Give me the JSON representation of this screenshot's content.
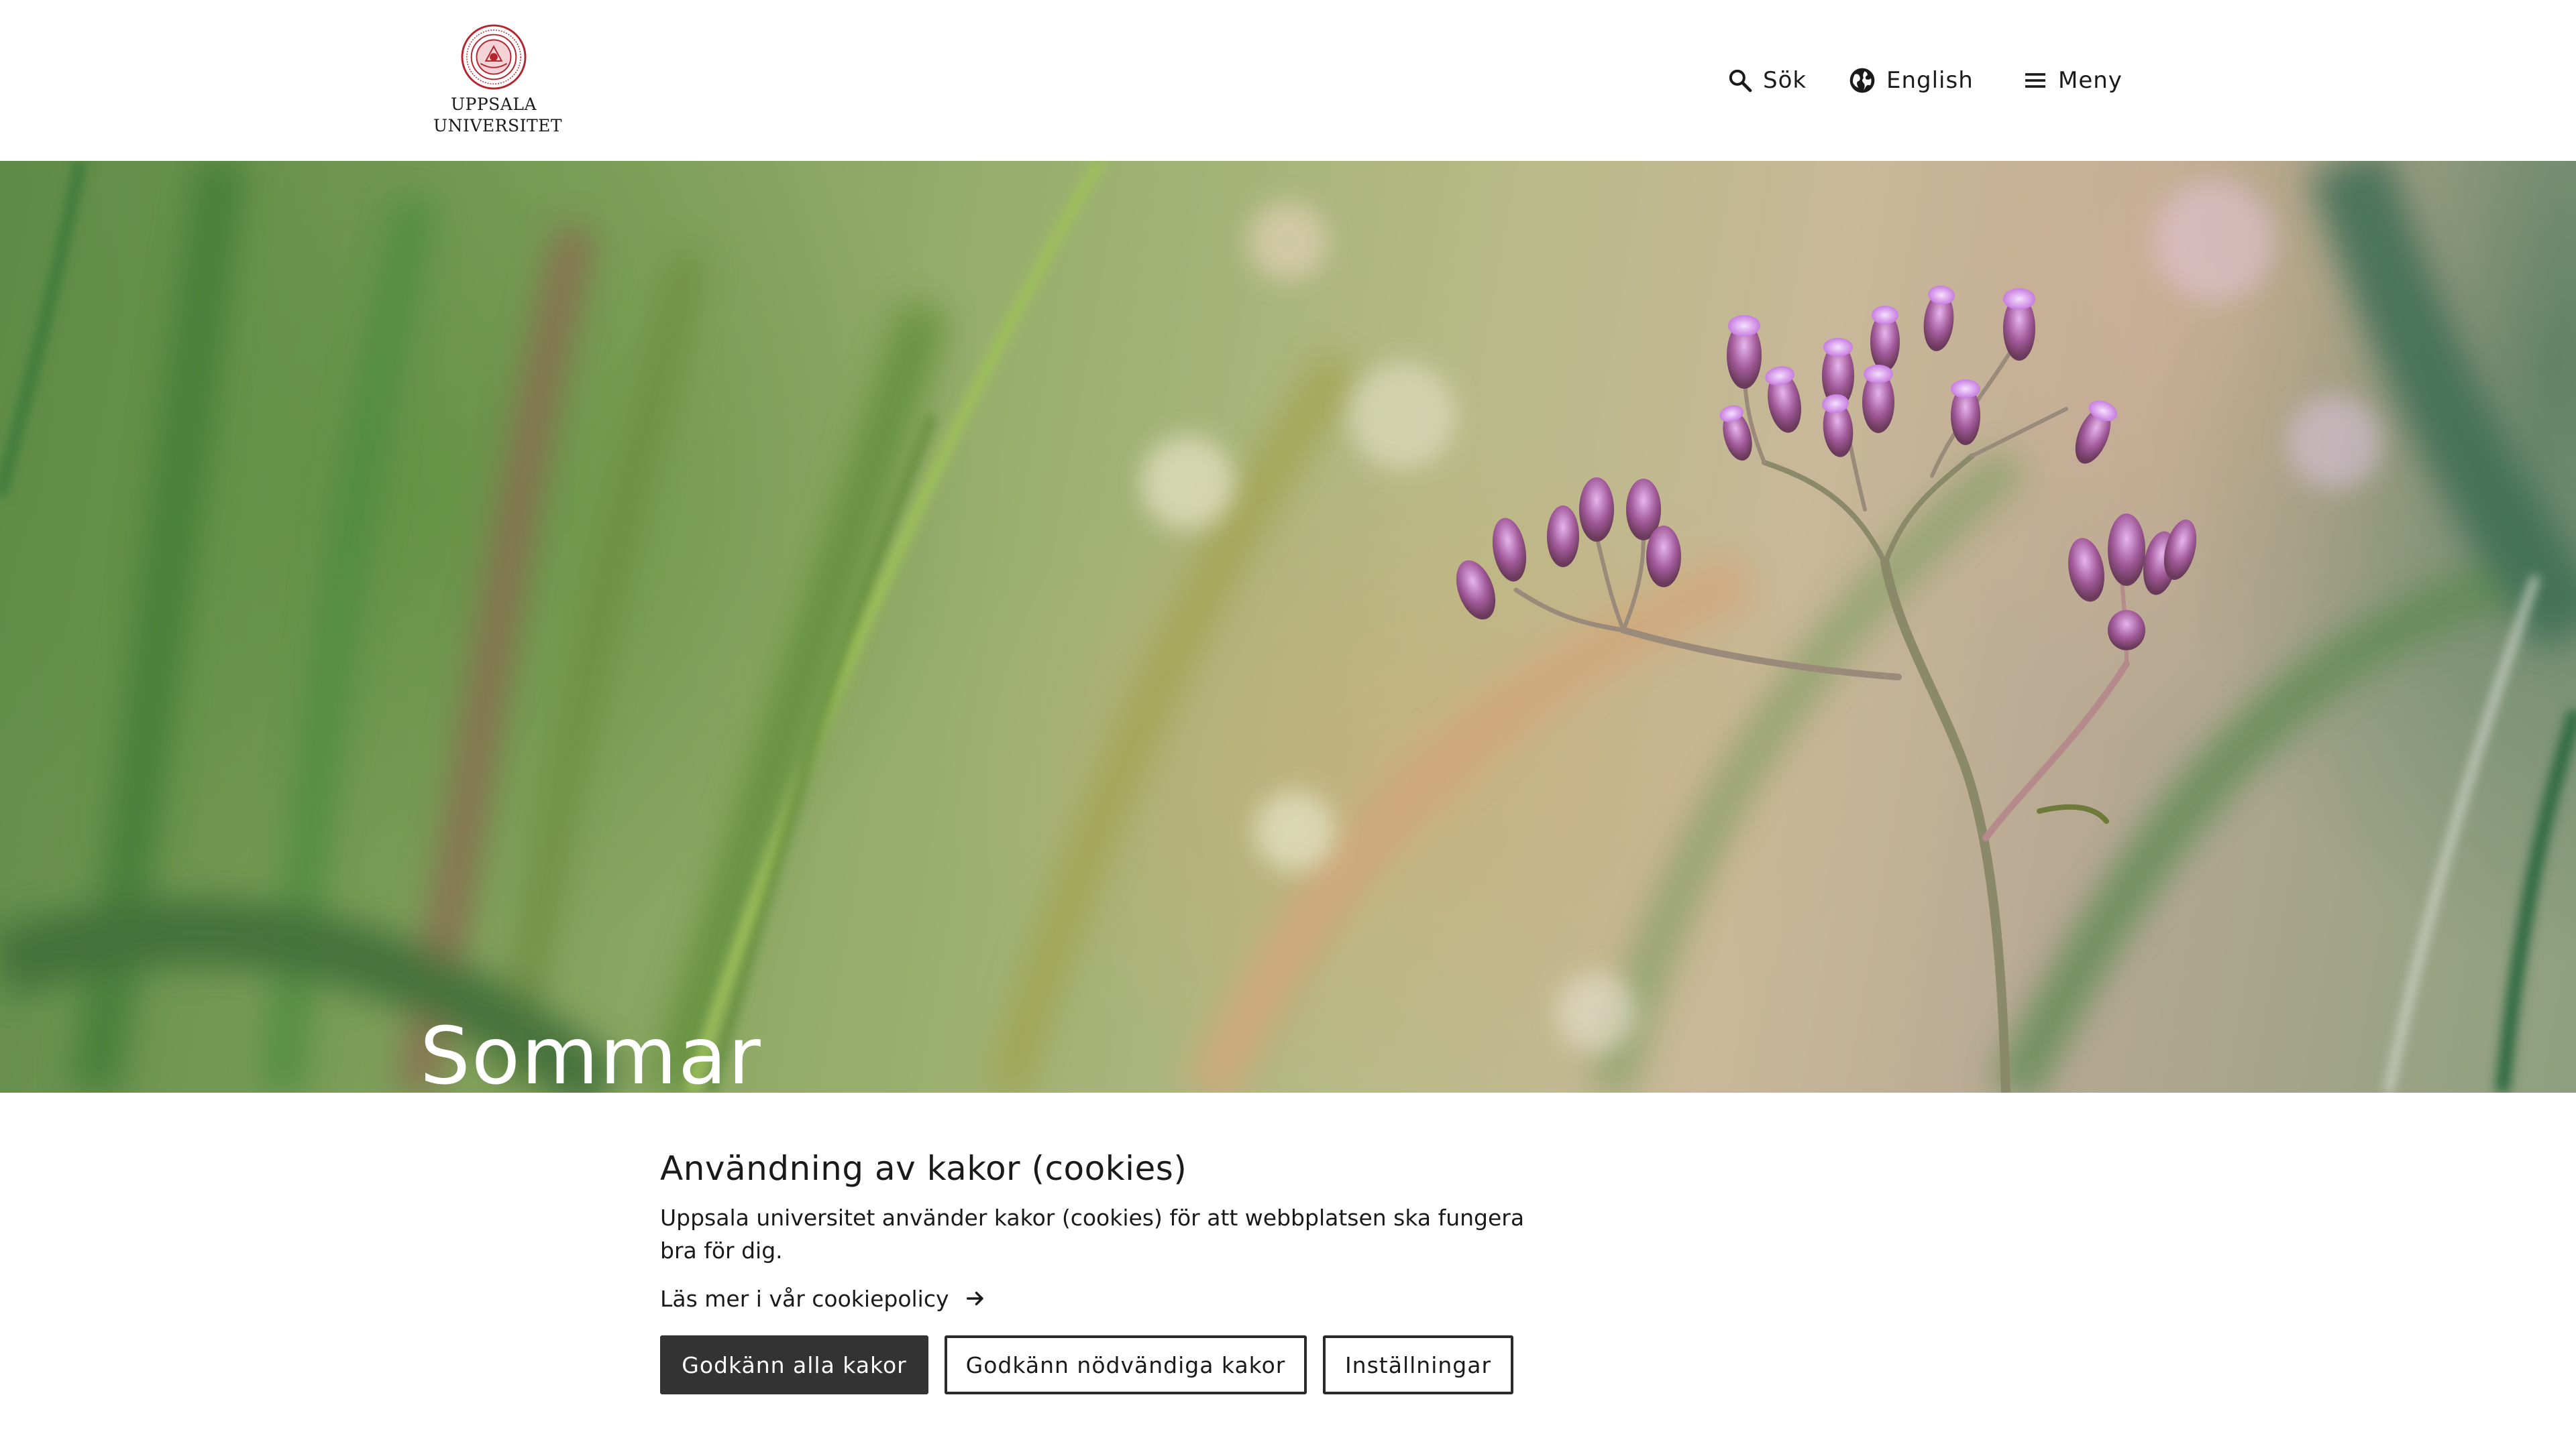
{
  "header": {
    "logo_line1": "UPPSALA",
    "logo_line2": "UNIVERSITET",
    "search_label": "Sök",
    "language_label": "English",
    "menu_label": "Meny"
  },
  "hero": {
    "title": "Sommar"
  },
  "cookie_banner": {
    "title": "Användning av kakor (cookies)",
    "text": "Uppsala universitet använder kakor (cookies) för att webbplatsen ska fungera bra för dig.",
    "policy_link": "Läs mer i vår cookiepolicy",
    "accept_all": "Godkänn alla kakor",
    "accept_necessary": "Godkänn nödvändiga kakor",
    "settings": "Inställningar"
  },
  "colors": {
    "seal_red": "#b5252f",
    "primary_button": "#333333",
    "text": "#1a1a1a"
  },
  "icons": [
    "search-icon",
    "globe-icon",
    "hamburger-menu-icon",
    "arrow-right-icon",
    "university-seal-logo"
  ]
}
